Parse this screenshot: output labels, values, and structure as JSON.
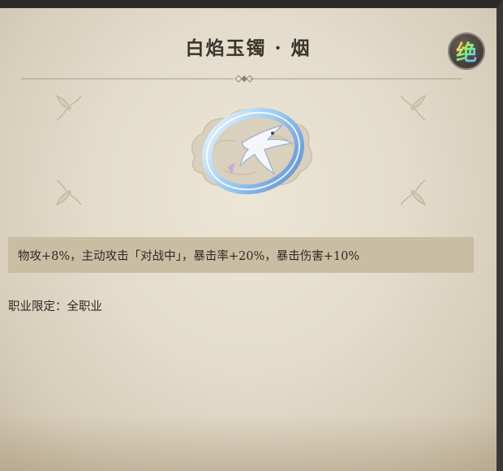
{
  "item": {
    "title": "白焰玉镯 · 烟",
    "rarity_glyph": "绝",
    "stat_line": "物攻+8%，主动攻击「对战中」，暴击率+20%，暴击伤害+10%",
    "restriction": "职业限定：全职业"
  },
  "colors": {
    "parchment": "#e3dccb",
    "stat_bar": "#c9bda4",
    "text": "#2f2a24",
    "title": "#3b352d"
  },
  "icons": [
    "rarity-badge-icon",
    "corner-ornament-icon",
    "jade-bracelet-icon"
  ]
}
